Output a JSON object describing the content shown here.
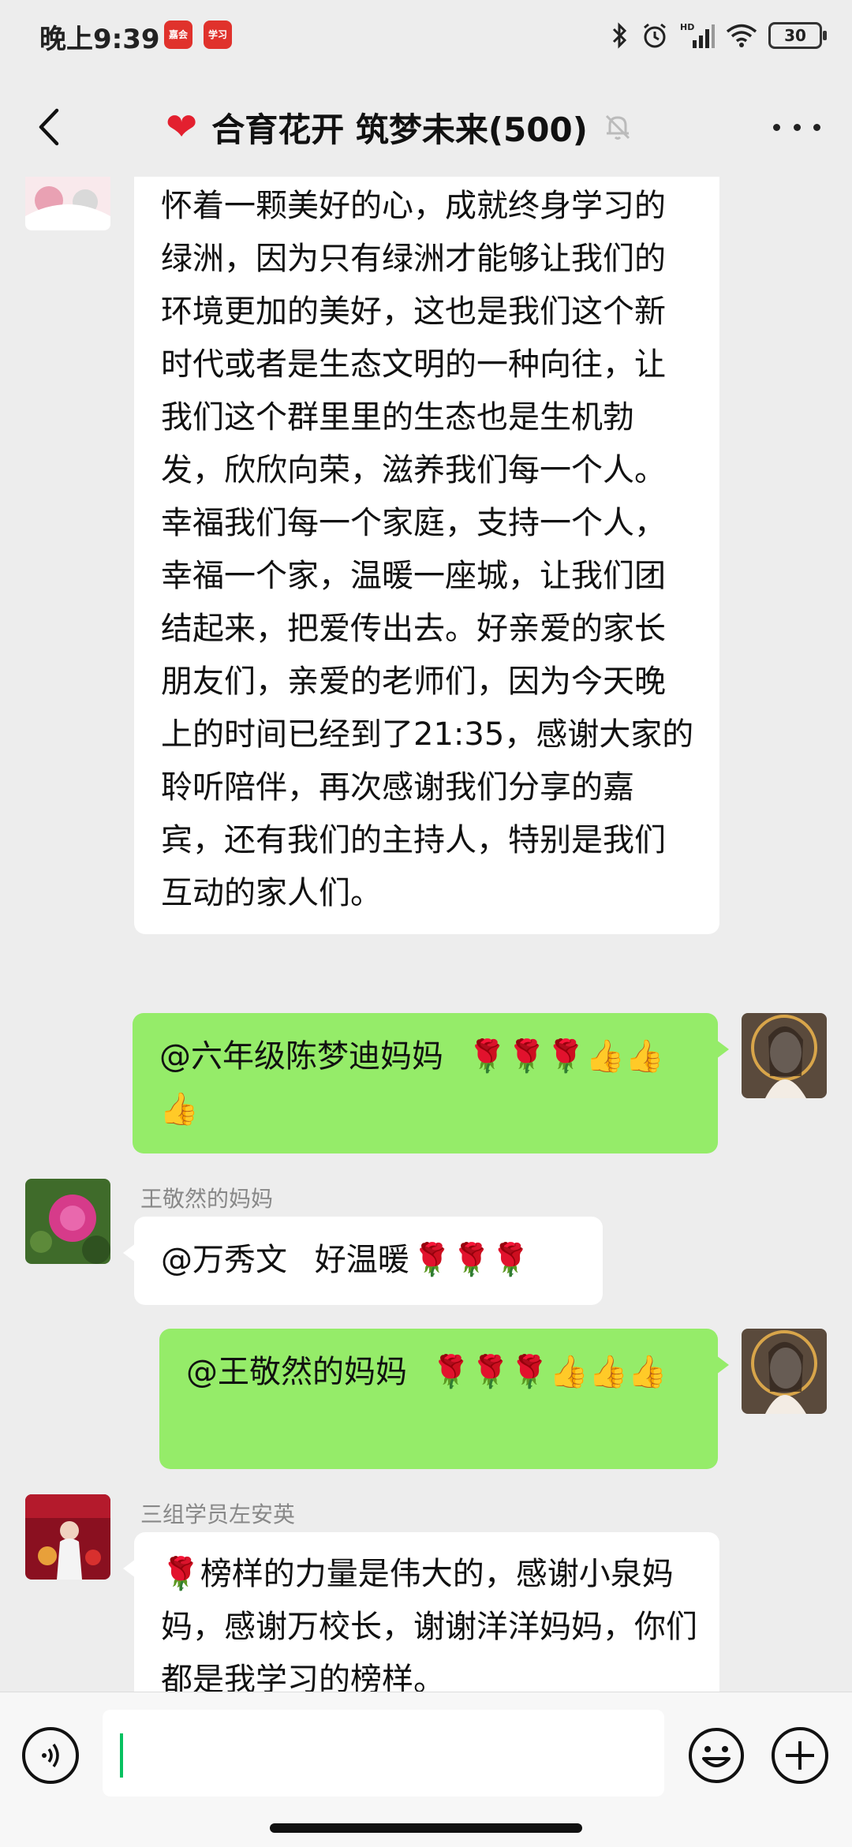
{
  "status_bar": {
    "time": "晚上9:39",
    "app_badge_1": "嘉会",
    "app_badge_2": "学习",
    "hd_label": "HD",
    "battery": "30"
  },
  "header": {
    "title": "合育花开 筑梦未来(500)"
  },
  "messages": [
    {
      "text": "怀着一颗美好的心，成就终身学习的绿洲，因为只有绿洲才能够让我们的环境更加的美好，这也是我们这个新时代或者是生态文明的一种向往，让我们这个群里里的生态也是生机勃发，欣欣向荣，滋养我们每一个人。幸福我们每一个家庭，支持一个人，幸福一个家，温暖一座城，让我们团结起来，把爱传出去。好亲爱的家长朋友们，亲爱的老师们，因为今天晚上的时间已经到了21:35，感谢大家的聆听陪伴，再次感谢我们分享的嘉宾，还有我们的主持人，特别是我们互动的家人们。"
    },
    {
      "mention": "@六年级陈梦迪妈妈",
      "emoji": "🌹🌹🌹👍👍👍"
    },
    {
      "sender": "王敬然的妈妈",
      "mention": "@万秀文",
      "text": "好温暖",
      "emoji": "🌹🌹🌹"
    },
    {
      "mention": "@王敬然的妈妈",
      "emoji": "🌹🌹🌹👍👍👍"
    },
    {
      "sender": "三组学员左安英",
      "emoji": "🌹",
      "text": "榜样的力量是伟大的，感谢小泉妈妈，感谢万校长，谢谢洋洋妈妈，你们都是我学习的榜样。"
    }
  ],
  "input": {
    "value": ""
  }
}
